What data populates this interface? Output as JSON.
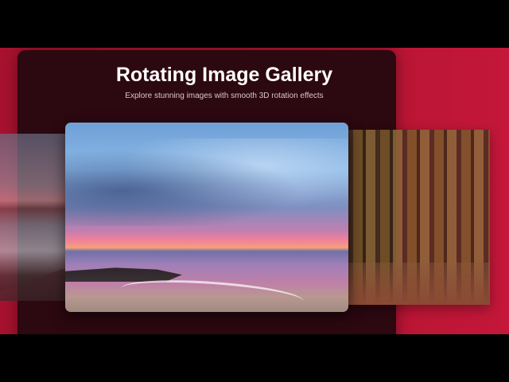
{
  "gallery": {
    "title": "Rotating Image Gallery",
    "subtitle": "Explore stunning images with smooth 3D rotation effects",
    "images": [
      {
        "name": "mountains-snow",
        "position": "left"
      },
      {
        "name": "sunset-beach",
        "position": "center"
      },
      {
        "name": "forest",
        "position": "right"
      }
    ]
  },
  "colors": {
    "background": "#b3142f",
    "panel": "#2c0810"
  }
}
